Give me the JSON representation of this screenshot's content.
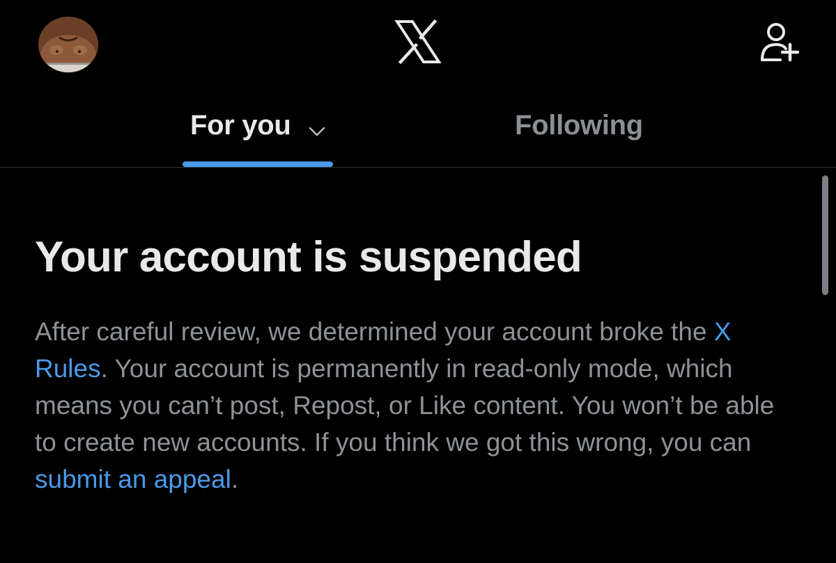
{
  "header": {
    "logo_text": "X",
    "avatar_icon": "user-avatar-photo",
    "follow_icon": "add-user-icon"
  },
  "tabs": [
    {
      "label": "For you",
      "active": true,
      "icon": "chevron-down-icon"
    },
    {
      "label": "Following",
      "active": false
    }
  ],
  "notice": {
    "title": "Your account is suspended",
    "body_part1": "After careful review, we determined your account broke the ",
    "rules_link": "X Rules",
    "body_part2": ". Your account is permanently in read-only mode, which means you can’t post, Repost, or Like content. You won’t be able to create new accounts. If you think we got this wrong, you can ",
    "appeal_link": "submit an appeal",
    "body_part3": "."
  },
  "colors": {
    "background": "#000000",
    "primary_text": "#e7e9ea",
    "secondary_text": "#8e9297",
    "accent": "#4a99e9",
    "divider": "#2f3336"
  }
}
